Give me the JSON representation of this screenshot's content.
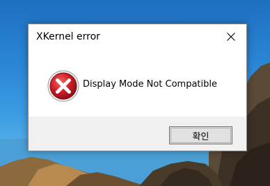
{
  "dialog": {
    "title": "XKernel error",
    "message": "Display Mode Not Compatible",
    "ok_label": "확인",
    "icon": "error-icon",
    "close_icon": "close-icon"
  },
  "colors": {
    "error_red": "#c8102e",
    "footer_bg": "#f0f0f0",
    "button_bg": "#e1e1e1"
  }
}
